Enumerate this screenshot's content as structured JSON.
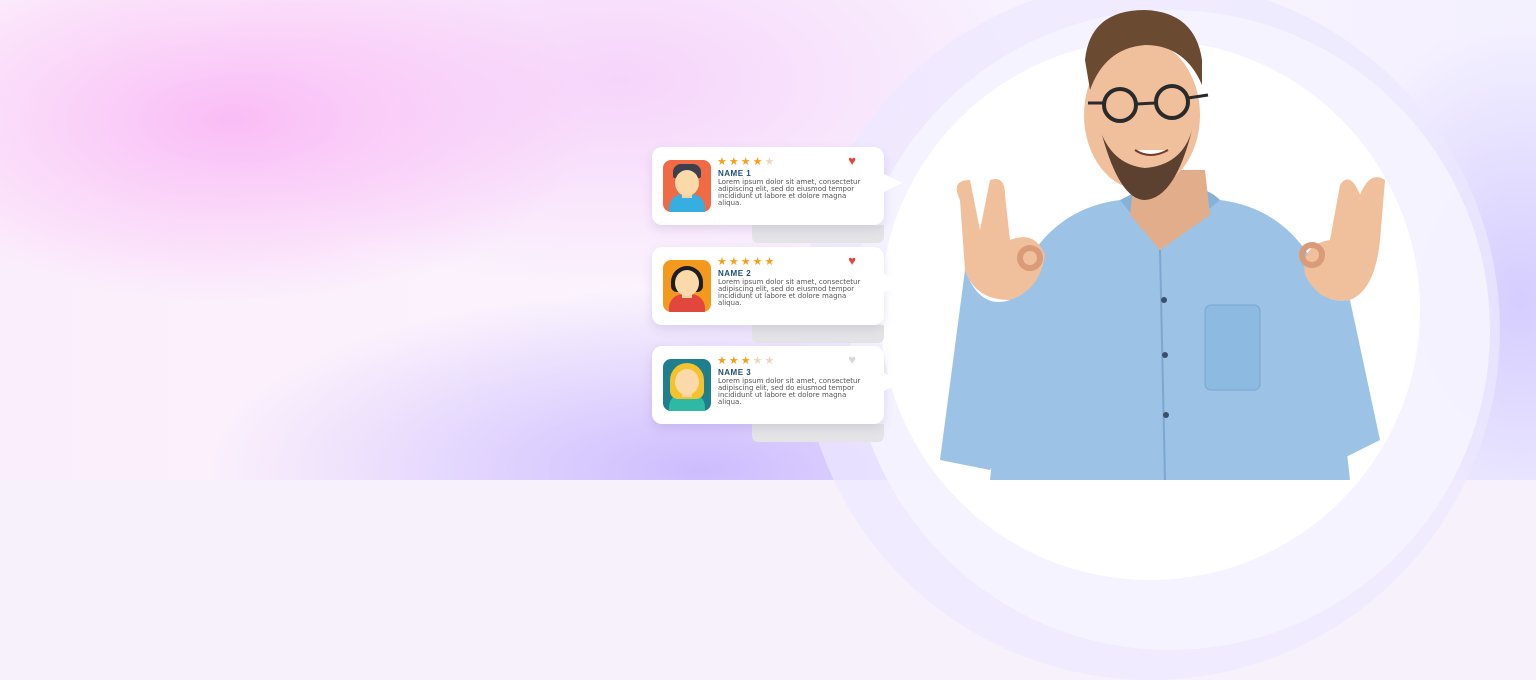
{
  "reviews": [
    {
      "name": "NAME 1",
      "rating": 4,
      "max_rating": 5,
      "favorited": true,
      "text": "Lorem ipsum dolor sit amet, consectetur adipiscing elit, sed do eiusmod tempor incididunt ut labore et dolore magna aliqua.",
      "avatar": {
        "bg": "#ef6a45",
        "shirt": "#36aee0",
        "hair": "#3c3f4c",
        "style": "short"
      }
    },
    {
      "name": "NAME 2",
      "rating": 5,
      "max_rating": 5,
      "favorited": true,
      "text": "Lorem ipsum dolor sit amet, consectetur adipiscing elit, sed do eiusmod tempor incididunt ut labore et dolore magna aliqua.",
      "avatar": {
        "bg": "#f39a1e",
        "shirt": "#e2473d",
        "hair": "#1d1d24",
        "style": "bob"
      }
    },
    {
      "name": "NAME 3",
      "rating": 3,
      "max_rating": 5,
      "favorited": false,
      "text": "Lorem ipsum dolor sit amet, consectetur adipiscing elit, sed do eiusmod tempor incididunt ut labore et dolore magna aliqua.",
      "avatar": {
        "bg": "#1f7f8c",
        "shirt": "#2fb9a4",
        "hair": "#f4c22b",
        "style": "long"
      }
    }
  ],
  "colors": {
    "star_on": "#f6a01a",
    "star_off": "#e7d9c2",
    "heart_on": "#e2453c",
    "heart_off": "#d7d7d9",
    "name": "#1f4d7a"
  },
  "icons": {
    "star": "star-icon",
    "heart": "heart-icon"
  }
}
